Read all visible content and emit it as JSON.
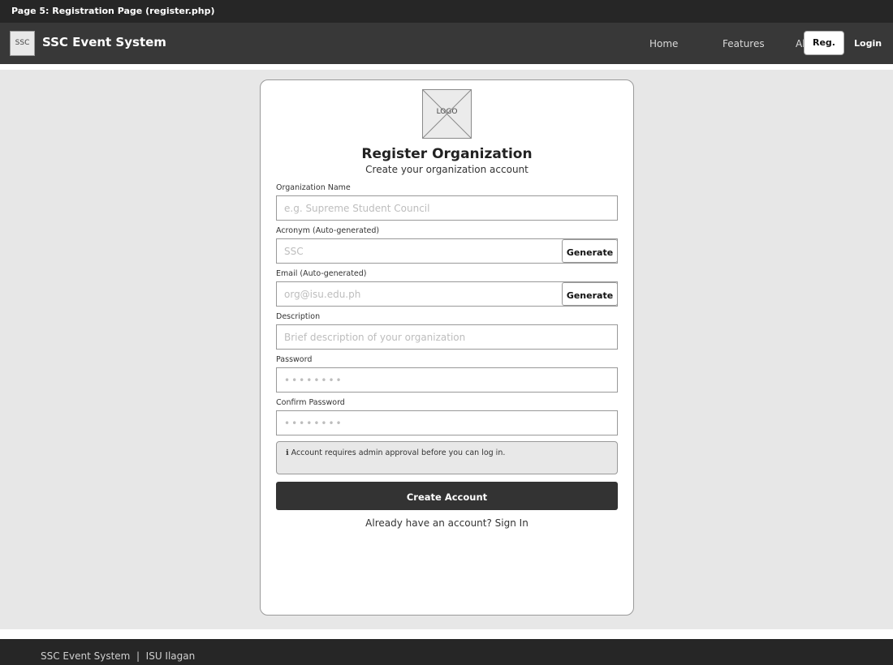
{
  "page_caption": "Page 5: Registration Page (register.php)",
  "navbar": {
    "logo_text": "SSC",
    "brand": "SSC Event System",
    "links": {
      "home": "Home",
      "features": "Features",
      "about": "About"
    },
    "register_button": "Reg.",
    "login_button": "Login"
  },
  "card": {
    "logo_placeholder": "LOGO",
    "title": "Register Organization",
    "subtitle": "Create your organization account",
    "fields": {
      "org_name": {
        "label": "Organization Name",
        "placeholder": "e.g. Supreme Student Council"
      },
      "acronym": {
        "label": "Acronym (Auto-generated)",
        "placeholder": "SSC",
        "button": "Generate"
      },
      "email": {
        "label": "Email (Auto-generated)",
        "placeholder": "org@isu.edu.ph",
        "button": "Generate"
      },
      "description": {
        "label": "Description",
        "placeholder": "Brief description of your organization"
      },
      "password": {
        "label": "Password",
        "placeholder": "••••••••"
      },
      "confirm_password": {
        "label": "Confirm Password",
        "placeholder": "••••••••"
      }
    },
    "notice": "ℹ Account requires admin approval before you can log in.",
    "create_button": "Create Account",
    "signin_prompt": "Already have an account? Sign In"
  },
  "footer": {
    "text": "SSC Event System  |  ISU Ilagan"
  }
}
